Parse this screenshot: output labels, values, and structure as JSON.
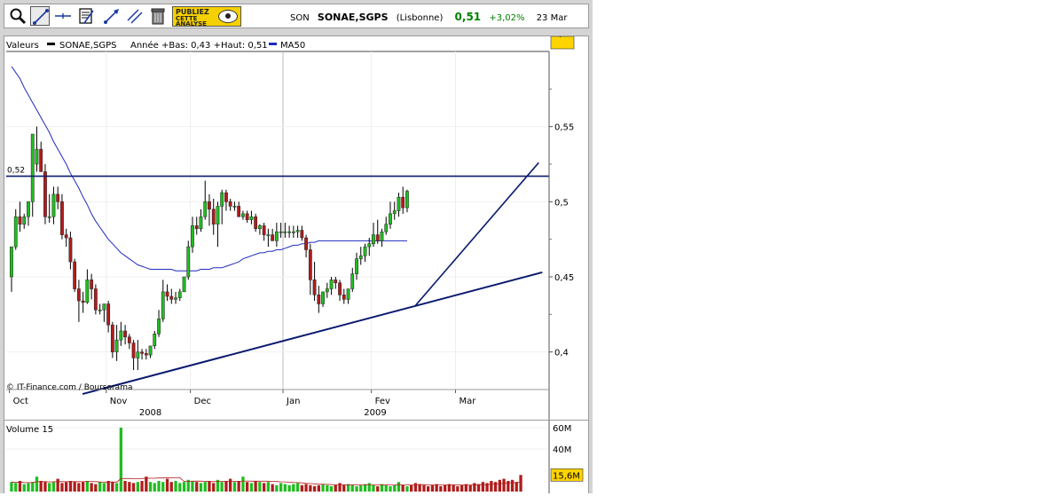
{
  "quote": {
    "code": "SON",
    "name": "SONAE,SGPS",
    "market": "(Lisbonne)",
    "price": "0,51",
    "change": "+3,02%",
    "date": "23 Mar"
  },
  "toolbar": {
    "tools": [
      "zoom-icon",
      "trendline-icon",
      "horizontal-line-icon",
      "text-note-icon",
      "arrow-line-icon",
      "parallel-lines-icon",
      "trash-icon"
    ],
    "pub": [
      "PUBLIEZ",
      "CETTE",
      "ANALYSE"
    ]
  },
  "legend": {
    "label": "Valeurs",
    "series": "SONAE,SGPS",
    "stats": "Année +Bas: 0,43 +Haut: 0,51",
    "ma": "MA50"
  },
  "credit": "© IT-Finance.com / Boursorama",
  "colors": {
    "up": "#20bd20",
    "down": "#b01c1c",
    "ma": "#1f2cc0",
    "lines": "#0a1a6e"
  },
  "chart_data": [
    {
      "type": "candlestick",
      "x": [
        "2008-10-01",
        "2008-10-02",
        "2008-10-03",
        "2008-10-06",
        "2008-10-07",
        "2008-10-08",
        "2008-10-09",
        "2008-10-10",
        "2008-10-13",
        "2008-10-14",
        "2008-10-15",
        "2008-10-16",
        "2008-10-17",
        "2008-10-20",
        "2008-10-21",
        "2008-10-22",
        "2008-10-23",
        "2008-10-24",
        "2008-10-27",
        "2008-10-28",
        "2008-10-29",
        "2008-10-30",
        "2008-10-31",
        "2008-11-03",
        "2008-11-04",
        "2008-11-05",
        "2008-11-06",
        "2008-11-07",
        "2008-11-10",
        "2008-11-11",
        "2008-11-12",
        "2008-11-13",
        "2008-11-14",
        "2008-11-17",
        "2008-11-18",
        "2008-11-19",
        "2008-11-20",
        "2008-11-21",
        "2008-11-24",
        "2008-11-25",
        "2008-11-26",
        "2008-11-27",
        "2008-11-28",
        "2008-12-01",
        "2008-12-02",
        "2008-12-03",
        "2008-12-04",
        "2008-12-05",
        "2008-12-08",
        "2008-12-09",
        "2008-12-10",
        "2008-12-11",
        "2008-12-12",
        "2008-12-15",
        "2008-12-16",
        "2008-12-17",
        "2008-12-18",
        "2008-12-19",
        "2008-12-22",
        "2008-12-23",
        "2008-12-24",
        "2008-12-26",
        "2008-12-29",
        "2008-12-30",
        "2008-12-31",
        "2009-01-02",
        "2009-01-05",
        "2009-01-06",
        "2009-01-07",
        "2009-01-08",
        "2009-01-09",
        "2009-01-12",
        "2009-01-13",
        "2009-01-14",
        "2009-01-15",
        "2009-01-16",
        "2009-01-19",
        "2009-01-20",
        "2009-01-21",
        "2009-01-22",
        "2009-01-23",
        "2009-01-26",
        "2009-01-27",
        "2009-01-28",
        "2009-01-29",
        "2009-01-30",
        "2009-02-02",
        "2009-02-03",
        "2009-02-04",
        "2009-02-05",
        "2009-02-06",
        "2009-02-09",
        "2009-02-10",
        "2009-02-11",
        "2009-02-12",
        "2009-02-13",
        "2009-02-16",
        "2009-02-17",
        "2009-02-18",
        "2009-02-19",
        "2009-02-20",
        "2009-02-23",
        "2009-02-24",
        "2009-02-25",
        "2009-02-26",
        "2009-02-27",
        "2009-03-02",
        "2009-03-03",
        "2009-03-04",
        "2009-03-05",
        "2009-03-06",
        "2009-03-09",
        "2009-03-10",
        "2009-03-11",
        "2009-03-12",
        "2009-03-13",
        "2009-03-16",
        "2009-03-17",
        "2009-03-18",
        "2009-03-19",
        "2009-03-20",
        "2009-03-23"
      ],
      "open": [
        0.45,
        0.47,
        0.49,
        0.485,
        0.49,
        0.5,
        0.525,
        0.535,
        0.52,
        0.49,
        0.49,
        0.505,
        0.5,
        0.478,
        0.476,
        0.46,
        0.442,
        0.434,
        0.433,
        0.448,
        0.442,
        0.428,
        0.428,
        0.432,
        0.418,
        0.4,
        0.408,
        0.414,
        0.41,
        0.406,
        0.396,
        0.4,
        0.399,
        0.398,
        0.404,
        0.412,
        0.422,
        0.44,
        0.437,
        0.435,
        0.436,
        0.44,
        0.45,
        0.47,
        0.484,
        0.482,
        0.49,
        0.5,
        0.495,
        0.485,
        0.497,
        0.506,
        0.5,
        0.497,
        0.497,
        0.49,
        0.492,
        0.488,
        0.49,
        0.482,
        0.484,
        0.478,
        0.478,
        0.474,
        0.48,
        0.48,
        0.48,
        0.48,
        0.48,
        0.481,
        0.476,
        0.468,
        0.448,
        0.438,
        0.432,
        0.44,
        0.442,
        0.448,
        0.446,
        0.438,
        0.435,
        0.442,
        0.452,
        0.462,
        0.464,
        0.47,
        0.472,
        0.478,
        0.474,
        0.48,
        0.485,
        0.492,
        0.494,
        0.503,
        0.496
      ],
      "high": [
        0.465,
        0.495,
        0.5,
        0.492,
        0.495,
        0.53,
        0.55,
        0.54,
        0.525,
        0.505,
        0.51,
        0.51,
        0.505,
        0.482,
        0.48,
        0.462,
        0.448,
        0.44,
        0.455,
        0.452,
        0.445,
        0.432,
        0.43,
        0.434,
        0.42,
        0.418,
        0.42,
        0.418,
        0.412,
        0.408,
        0.408,
        0.402,
        0.402,
        0.404,
        0.414,
        0.428,
        0.448,
        0.445,
        0.442,
        0.44,
        0.442,
        0.45,
        0.474,
        0.49,
        0.49,
        0.495,
        0.514,
        0.505,
        0.502,
        0.5,
        0.508,
        0.508,
        0.502,
        0.5,
        0.5,
        0.494,
        0.494,
        0.494,
        0.492,
        0.485,
        0.486,
        0.482,
        0.482,
        0.486,
        0.486,
        0.486,
        0.484,
        0.484,
        0.484,
        0.484,
        0.478,
        0.472,
        0.46,
        0.444,
        0.44,
        0.446,
        0.45,
        0.45,
        0.448,
        0.442,
        0.442,
        0.456,
        0.466,
        0.47,
        0.472,
        0.476,
        0.486,
        0.488,
        0.482,
        0.49,
        0.5,
        0.5,
        0.506,
        0.51,
        0.508
      ],
      "low": [
        0.44,
        0.468,
        0.48,
        0.482,
        0.484,
        0.49,
        0.52,
        0.52,
        0.485,
        0.486,
        0.485,
        0.495,
        0.475,
        0.47,
        0.455,
        0.44,
        0.42,
        0.426,
        0.432,
        0.435,
        0.425,
        0.425,
        0.42,
        0.413,
        0.396,
        0.394,
        0.404,
        0.405,
        0.402,
        0.388,
        0.388,
        0.395,
        0.395,
        0.396,
        0.402,
        0.41,
        0.42,
        0.434,
        0.432,
        0.432,
        0.434,
        0.44,
        0.448,
        0.466,
        0.478,
        0.48,
        0.488,
        0.484,
        0.478,
        0.47,
        0.485,
        0.494,
        0.494,
        0.494,
        0.49,
        0.488,
        0.486,
        0.485,
        0.48,
        0.478,
        0.474,
        0.47,
        0.474,
        0.47,
        0.476,
        0.476,
        0.476,
        0.476,
        0.476,
        0.474,
        0.463,
        0.438,
        0.434,
        0.426,
        0.43,
        0.436,
        0.438,
        0.442,
        0.434,
        0.432,
        0.432,
        0.44,
        0.448,
        0.458,
        0.46,
        0.464,
        0.47,
        0.472,
        0.47,
        0.478,
        0.482,
        0.488,
        0.49,
        0.492,
        0.493
      ],
      "close": [
        0.47,
        0.49,
        0.485,
        0.49,
        0.5,
        0.545,
        0.535,
        0.52,
        0.49,
        0.49,
        0.505,
        0.5,
        0.478,
        0.476,
        0.46,
        0.442,
        0.434,
        0.433,
        0.448,
        0.442,
        0.428,
        0.428,
        0.432,
        0.418,
        0.4,
        0.408,
        0.414,
        0.41,
        0.406,
        0.396,
        0.4,
        0.399,
        0.398,
        0.404,
        0.412,
        0.422,
        0.44,
        0.437,
        0.435,
        0.436,
        0.44,
        0.45,
        0.47,
        0.484,
        0.482,
        0.49,
        0.5,
        0.495,
        0.485,
        0.497,
        0.506,
        0.5,
        0.497,
        0.497,
        0.49,
        0.492,
        0.488,
        0.49,
        0.482,
        0.484,
        0.478,
        0.478,
        0.474,
        0.48,
        0.48,
        0.48,
        0.48,
        0.48,
        0.481,
        0.476,
        0.468,
        0.448,
        0.438,
        0.432,
        0.44,
        0.442,
        0.448,
        0.446,
        0.438,
        0.435,
        0.442,
        0.452,
        0.462,
        0.464,
        0.47,
        0.472,
        0.478,
        0.474,
        0.48,
        0.485,
        0.492,
        0.494,
        0.503,
        0.496,
        0.507
      ],
      "ma50": [
        0.59,
        0.586,
        0.582,
        0.576,
        0.571,
        0.566,
        0.561,
        0.556,
        0.551,
        0.546,
        0.54,
        0.535,
        0.53,
        0.525,
        0.519,
        0.514,
        0.509,
        0.503,
        0.498,
        0.492,
        0.487,
        0.483,
        0.479,
        0.475,
        0.472,
        0.469,
        0.466,
        0.464,
        0.462,
        0.46,
        0.458,
        0.457,
        0.456,
        0.455,
        0.455,
        0.455,
        0.455,
        0.455,
        0.455,
        0.454,
        0.454,
        0.454,
        0.454,
        0.454,
        0.454,
        0.455,
        0.455,
        0.455,
        0.456,
        0.456,
        0.456,
        0.457,
        0.458,
        0.459,
        0.46,
        0.462,
        0.463,
        0.464,
        0.465,
        0.466,
        0.466,
        0.467,
        0.467,
        0.468,
        0.468,
        0.469,
        0.47,
        0.471,
        0.471,
        0.472,
        0.472,
        0.473,
        0.473,
        0.474,
        0.474,
        0.474,
        0.474,
        0.474,
        0.474,
        0.474,
        0.474,
        0.474,
        0.474,
        0.474,
        0.474,
        0.474,
        0.474,
        0.474,
        0.474,
        0.474,
        0.474,
        0.474,
        0.474,
        0.474,
        0.474
      ],
      "y_ticks": [
        "0,55",
        "0,5",
        "0,45",
        "0,4"
      ],
      "y_tick_values": [
        0.55,
        0.5,
        0.45,
        0.4
      ],
      "ylim": [
        0.375,
        0.6
      ],
      "x_labels": [
        "Oct",
        "Nov",
        "Dec",
        "Jan",
        "Fev",
        "Mar"
      ],
      "years": [
        "2008",
        "2009"
      ],
      "last_label": "0,51",
      "resistance": {
        "value": 0.517,
        "label": "0,52"
      },
      "support_line": {
        "from": [
          0,
          0.372
        ],
        "to": [
          124,
          0.453
        ]
      },
      "trend_line": {
        "from": [
          96,
          0.431
        ],
        "to": [
          124,
          0.526
        ]
      },
      "grid": true
    },
    {
      "type": "bar",
      "title": "Volume 15",
      "y_ticks": [
        "60M",
        "40M"
      ],
      "y_tick_values": [
        60,
        40
      ],
      "last_label": "15,6M",
      "ylim": [
        0,
        65
      ],
      "values": [
        9,
        8,
        10,
        7,
        8,
        9,
        14,
        10,
        9,
        8,
        9,
        12,
        8,
        9,
        10,
        9,
        8,
        9,
        10,
        8,
        7,
        9,
        8,
        10,
        9,
        8,
        60,
        10,
        9,
        8,
        9,
        10,
        14,
        9,
        8,
        10,
        9,
        12,
        9,
        10,
        8,
        9,
        11,
        10,
        9,
        8,
        9,
        10,
        8,
        11,
        9,
        10,
        12,
        9,
        10,
        14,
        9,
        8,
        10,
        9,
        8,
        9,
        7,
        6,
        8,
        7,
        6,
        7,
        8,
        6,
        7,
        6,
        5,
        6,
        7,
        6,
        5,
        6,
        8,
        6,
        7,
        6,
        5,
        6,
        7,
        8,
        6,
        5,
        7,
        6,
        5,
        6,
        9,
        6,
        5,
        6,
        8,
        7,
        6,
        5,
        6,
        7,
        5,
        6,
        7,
        6,
        5,
        6,
        7,
        6,
        8,
        7,
        9,
        8,
        10,
        9,
        11,
        12,
        10,
        11,
        9,
        15.6
      ]
    }
  ]
}
